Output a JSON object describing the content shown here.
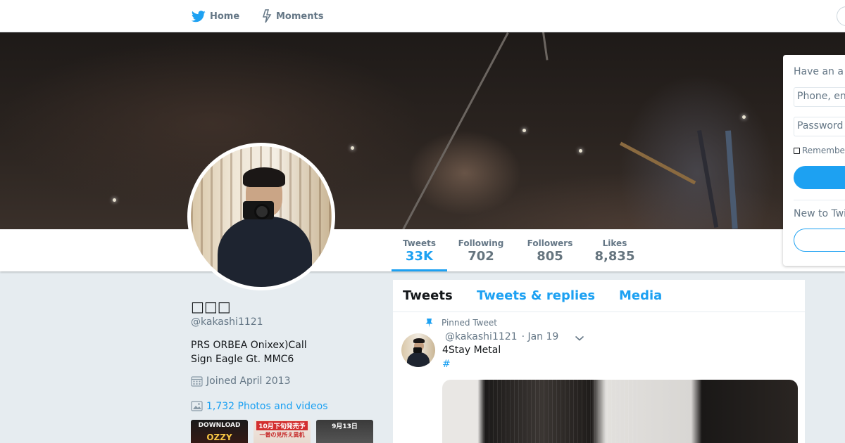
{
  "nav": {
    "home_label": "Home",
    "moments_label": "Moments"
  },
  "stats": [
    {
      "label": "Tweets",
      "value": "33K"
    },
    {
      "label": "Following",
      "value": "702"
    },
    {
      "label": "Followers",
      "value": "805"
    },
    {
      "label": "Likes",
      "value": "8,835"
    }
  ],
  "profile": {
    "name": "□□□",
    "handle": "@kakashi1121",
    "bio": "PRS ORBEA Onixex)Call\nSign Eagle Gt.  MMC6",
    "joined": "Joined April 2013",
    "photos_link": "1,732 Photos and videos",
    "thumbs": [
      {
        "line1": "DOWNLOAD",
        "line2": "OZZY"
      },
      {
        "line1": "10月下旬発売予",
        "line2": "一番の見所え異机"
      },
      {
        "line1": "9月13日"
      }
    ]
  },
  "timeline": {
    "tabs": [
      "Tweets",
      "Tweets & replies",
      "Media"
    ],
    "pinned_label": "Pinned Tweet",
    "tweet": {
      "handle": "@kakashi1121",
      "date": "· Jan 19",
      "text": "4Stay Metal",
      "hashtag": "#"
    }
  },
  "login": {
    "title": "Have an a",
    "phone_placeholder": "Phone, en",
    "password_placeholder": "Password",
    "remember": "Remembe",
    "new_prompt": "New to Twi"
  },
  "colors": {
    "accent": "#1da1f2",
    "muted": "#657786",
    "background": "#e6ecf0"
  }
}
